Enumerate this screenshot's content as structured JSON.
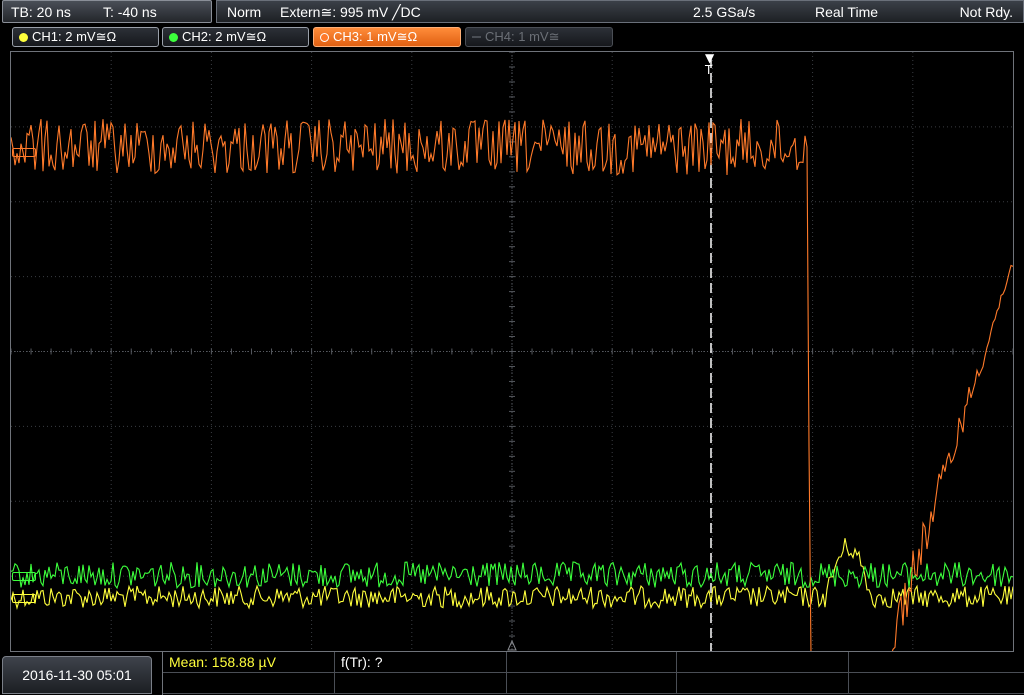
{
  "timebase": {
    "tb": "TB: 20 ns",
    "trigger_pos": "T: -40 ns"
  },
  "status": {
    "mode": "Norm",
    "trigger_source": "Extern≅: 995 mV ╱DC",
    "sample_rate": "2.5 GSa/s",
    "acq_mode": "Real Time",
    "state": "Not Rdy."
  },
  "channels": [
    {
      "label": "CH1: 2 mV≅Ω",
      "color": "#ffff3c",
      "active": false,
      "enabled": true
    },
    {
      "label": "CH2: 2 mV≅Ω",
      "color": "#3cff3c",
      "active": false,
      "enabled": true
    },
    {
      "label": "CH3: 1 mV≅Ω",
      "color": "#ff7a2a",
      "active": true,
      "enabled": true
    },
    {
      "label": "CH4: 1 mV≅",
      "color": "#6b6f76",
      "active": false,
      "enabled": false
    }
  ],
  "trigger_marker": "T",
  "datetime": "2016-11-30 05:01",
  "measurements": {
    "mean": "Mean: 158.88 µV",
    "ftr": "f(Tr): ?"
  },
  "colors": {
    "ch1": "#ffff3c",
    "ch2": "#3cff3c",
    "ch3": "#ff7a2a",
    "grid": "#3a3d42"
  }
}
